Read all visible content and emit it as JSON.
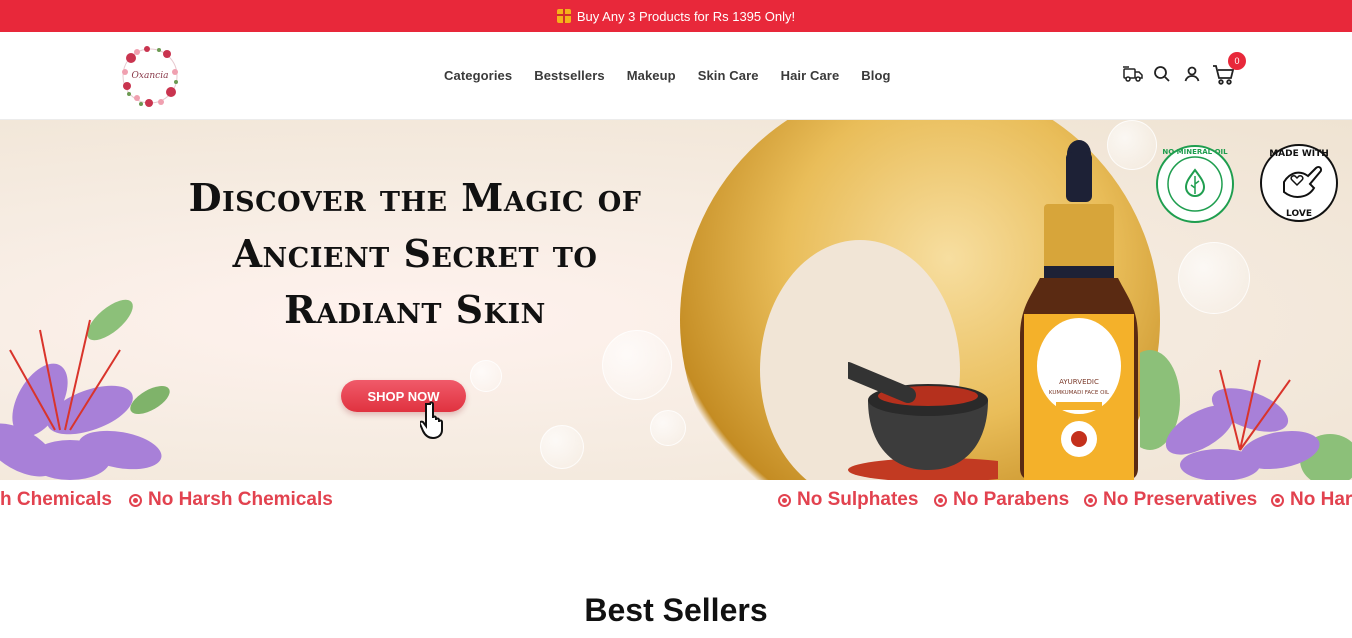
{
  "announcement": {
    "text": "Buy Any 3 Products for Rs 1395 Only!",
    "icon": "gift-icon"
  },
  "header": {
    "logo_text": "Oxancia",
    "nav": [
      "Categories",
      "Bestsellers",
      "Makeup",
      "Skin Care",
      "Hair Care",
      "Blog"
    ],
    "icons": [
      "delivery-truck-icon",
      "search-icon",
      "account-icon",
      "cart-icon"
    ],
    "cart_count": "0"
  },
  "hero": {
    "headline_line1": "Discover the Magic of",
    "headline_line2": "Ancient Secret to",
    "headline_line3": "Radiant Skin",
    "cta_label": "SHOP NOW",
    "badge_left_text": "NO MINERAL OIL",
    "badge_right_line1": "MADE WITH",
    "badge_right_line2": "LOVE",
    "bottle_label_line1": "AYURVEDIC",
    "bottle_label_line2": "KUMKUMADI FACE OIL"
  },
  "marquee": {
    "items": [
      "h Chemicals",
      "No Harsh Chemicals",
      "No Sulphates",
      "No Parabens",
      "No Preservatives",
      "No Har"
    ]
  },
  "best_sellers": {
    "title": "Best Sellers"
  },
  "colors": {
    "accent": "#e8283a",
    "marquee": "#e2424f"
  }
}
